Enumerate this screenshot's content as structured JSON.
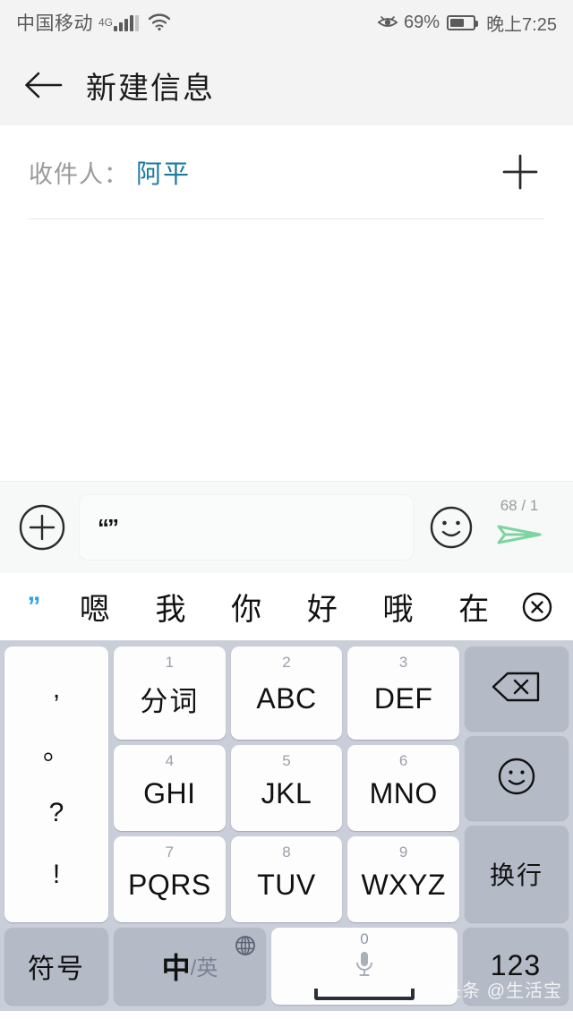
{
  "status_bar": {
    "carrier": "中国移动",
    "network": "4G",
    "eye_icon": "eye-comfort-icon",
    "battery_percent": "69%",
    "time": "晚上7:25"
  },
  "header": {
    "back_icon": "back-arrow-icon",
    "title": "新建信息"
  },
  "recipient": {
    "label": "收件人：",
    "name": "阿平",
    "name_color": "#1a7a9e",
    "add_icon": "plus-icon"
  },
  "input_bar": {
    "add_icon": "plus-circle-icon",
    "text_value": "“”",
    "placeholder": "",
    "emoji_icon": "smiley-icon",
    "counter": "68 / 1",
    "send_icon": "send-plane-icon",
    "send_color": "#7ed4a0"
  },
  "candidate_bar": {
    "composing": "”",
    "candidates": [
      "嗯",
      "我",
      "你",
      "好",
      "哦",
      "在"
    ],
    "close_icon": "circle-close-icon",
    "composing_color": "#2aa3e8"
  },
  "keyboard": {
    "punctuation": [
      ",",
      "。",
      "?",
      "!"
    ],
    "keys": [
      {
        "num": "1",
        "label": "分词",
        "cjk": true
      },
      {
        "num": "2",
        "label": "ABC",
        "cjk": false
      },
      {
        "num": "3",
        "label": "DEF",
        "cjk": false
      },
      {
        "num": "4",
        "label": "GHI",
        "cjk": false
      },
      {
        "num": "5",
        "label": "JKL",
        "cjk": false
      },
      {
        "num": "6",
        "label": "MNO",
        "cjk": false
      },
      {
        "num": "7",
        "label": "PQRS",
        "cjk": false
      },
      {
        "num": "8",
        "label": "TUV",
        "cjk": false
      },
      {
        "num": "9",
        "label": "WXYZ",
        "cjk": false
      }
    ],
    "delete_icon": "backspace-icon",
    "emoji_icon": "smiley-icon",
    "return_label": "换行",
    "symbol_label": "符号",
    "lang_primary": "中",
    "lang_secondary": "/英",
    "globe_icon": "globe-icon",
    "space_num": "0",
    "mic_icon": "microphone-icon",
    "numeric_label": "123"
  },
  "watermark": {
    "text": "头条 @生活宝"
  }
}
